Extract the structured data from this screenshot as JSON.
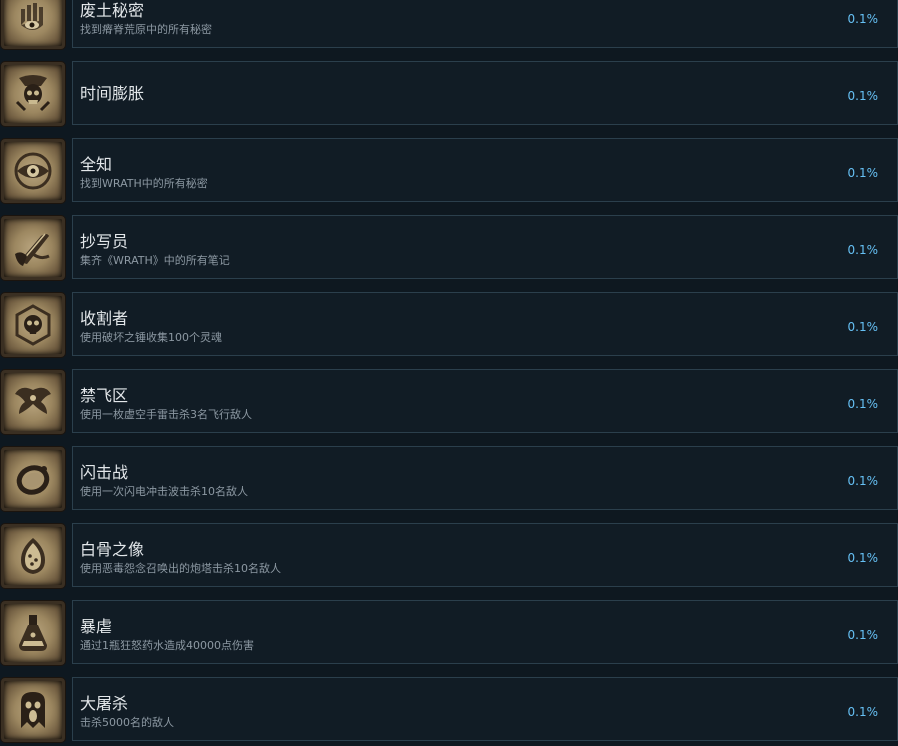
{
  "achievements": [
    {
      "name": "废土秘密",
      "description": "找到瘠脊荒原中的所有秘密",
      "percent": "0.1%",
      "icon": "eye-hand-icon"
    },
    {
      "name": "时间膨胀",
      "description": "",
      "percent": "0.1%",
      "icon": "skull-hourglass-icon"
    },
    {
      "name": "全知",
      "description": "找到WRATH中的所有秘密",
      "percent": "0.1%",
      "icon": "all-seeing-eye-icon"
    },
    {
      "name": "抄写员",
      "description": "集齐《WRATH》中的所有笔记",
      "percent": "0.1%",
      "icon": "scroll-quill-icon"
    },
    {
      "name": "收割者",
      "description": "使用破坏之锤收集100个灵魂",
      "percent": "0.1%",
      "icon": "reaper-skull-icon"
    },
    {
      "name": "禁飞区",
      "description": "使用一枚虚空手雷击杀3名飞行敌人",
      "percent": "0.1%",
      "icon": "winged-creature-icon"
    },
    {
      "name": "闪击战",
      "description": "使用一次闪电冲击波击杀10名敌人",
      "percent": "0.1%",
      "icon": "ring-icon"
    },
    {
      "name": "白骨之像",
      "description": "使用恶毒怨念召唤出的炮塔击杀10名敌人",
      "percent": "0.1%",
      "icon": "bone-egg-icon"
    },
    {
      "name": "暴虐",
      "description": "通过1瓶狂怒药水造成40000点伤害",
      "percent": "0.1%",
      "icon": "potion-flask-icon"
    },
    {
      "name": "大屠杀",
      "description": "击杀5000名的敌人",
      "percent": "0.1%",
      "icon": "screaming-face-icon"
    }
  ]
}
